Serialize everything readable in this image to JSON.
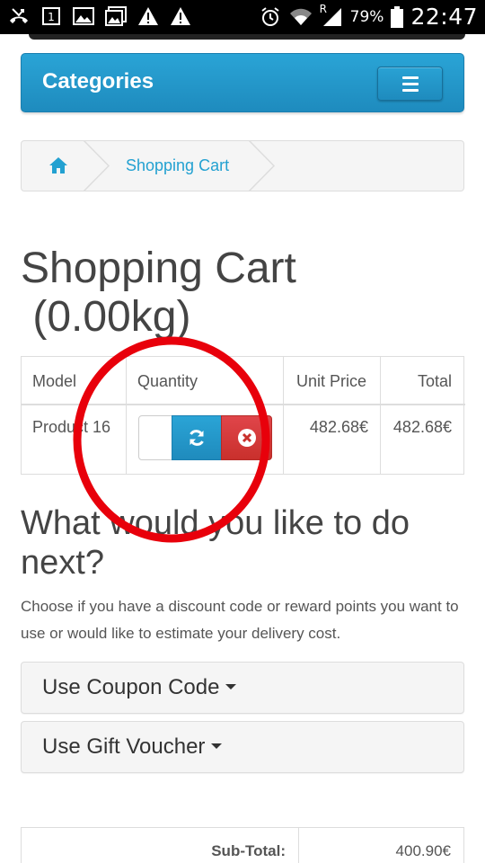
{
  "status_bar": {
    "battery": "79%",
    "time": "22:47",
    "network_label": "R",
    "notif_badge": "1"
  },
  "nav": {
    "categories_label": "Categories"
  },
  "breadcrumb": {
    "items": [
      "Shopping Cart"
    ]
  },
  "page": {
    "title": "Shopping Cart",
    "weight": " (0.00kg)"
  },
  "cart": {
    "headers": {
      "model": "Model",
      "quantity": "Quantity",
      "unit_price": "Unit Price",
      "total": "Total"
    },
    "rows": [
      {
        "model": "Product 16",
        "quantity": "",
        "unit_price": "482.68€",
        "total": "482.68€"
      }
    ]
  },
  "next": {
    "title": "What would you like to do next?",
    "description": "Choose if you have a discount code or reward points you want to use or would like to estimate your delivery cost.",
    "options": [
      "Use Coupon Code",
      "Use Gift Voucher"
    ]
  },
  "totals": {
    "rows": [
      {
        "label": "Sub-Total:",
        "value": "400.90€"
      }
    ]
  },
  "colors": {
    "primary": "#1e8bbe",
    "danger": "#c9302c",
    "annotation": "#e8000b",
    "link": "#23a1d1"
  },
  "icons": {
    "home": "home-icon",
    "refresh": "refresh-icon",
    "remove": "remove-circle-icon",
    "menu": "hamburger-icon"
  }
}
